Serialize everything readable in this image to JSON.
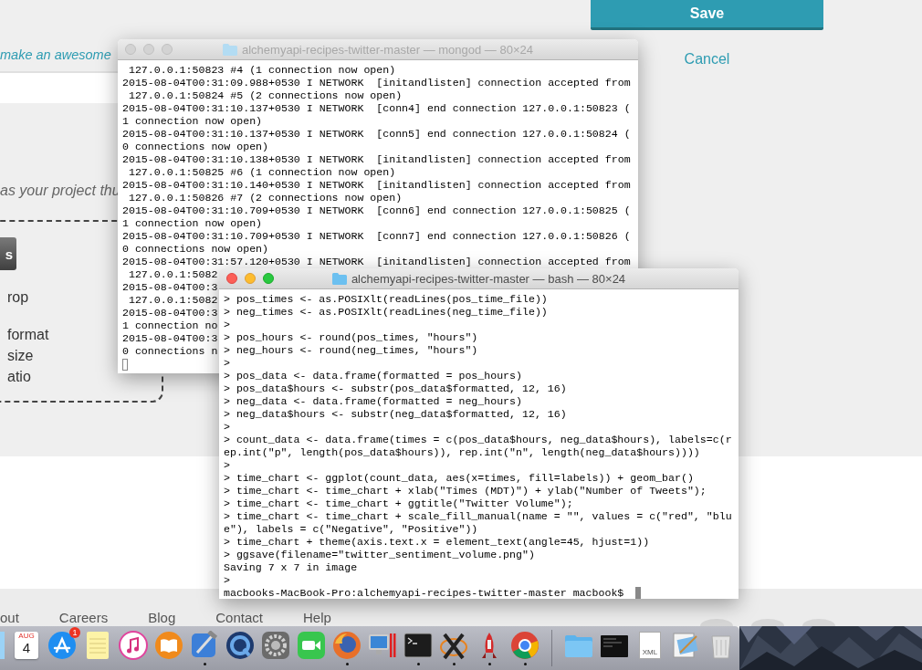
{
  "web_page": {
    "tagline": "make an awesome",
    "thumbnail_hint": "as your project thu",
    "upload_button": "s",
    "drop_hint": "rop",
    "requirements": [
      "format",
      "size",
      "atio"
    ],
    "save_button": "Save",
    "cancel_link": "Cancel",
    "footer_links": [
      "out",
      "Careers",
      "Blog",
      "Contact",
      "Help"
    ]
  },
  "windows": [
    {
      "title": "alchemyapi-recipes-twitter-master — mongod — 80×24",
      "active": false,
      "lines": [
        " 127.0.0.1:50823 #4 (1 connection now open)",
        "2015-08-04T00:31:09.988+0530 I NETWORK  [initandlisten] connection accepted from",
        " 127.0.0.1:50824 #5 (2 connections now open)",
        "2015-08-04T00:31:10.137+0530 I NETWORK  [conn4] end connection 127.0.0.1:50823 (",
        "1 connection now open)",
        "2015-08-04T00:31:10.137+0530 I NETWORK  [conn5] end connection 127.0.0.1:50824 (",
        "0 connections now open)",
        "2015-08-04T00:31:10.138+0530 I NETWORK  [initandlisten] connection accepted from",
        " 127.0.0.1:50825 #6 (1 connection now open)",
        "2015-08-04T00:31:10.140+0530 I NETWORK  [initandlisten] connection accepted from",
        " 127.0.0.1:50826 #7 (2 connections now open)",
        "2015-08-04T00:31:10.709+0530 I NETWORK  [conn6] end connection 127.0.0.1:50825 (",
        "1 connection now open)",
        "2015-08-04T00:31:10.709+0530 I NETWORK  [conn7] end connection 127.0.0.1:50826 (",
        "0 connections now open)",
        "2015-08-04T00:31:57.120+0530 I NETWORK  [initandlisten] connection accepted from",
        " 127.0.0.1:5082",
        "2015-08-04T00:3",
        " 127.0.0.1:5082",
        "2015-08-04T00:3",
        "1 connection no",
        "2015-08-04T00:3",
        "0 connections n"
      ]
    },
    {
      "title": "alchemyapi-recipes-twitter-master — bash — 80×24",
      "active": true,
      "lines": [
        "> pos_times <- as.POSIXlt(readLines(pos_time_file))",
        "> neg_times <- as.POSIXlt(readLines(neg_time_file))",
        ">",
        "> pos_hours <- round(pos_times, \"hours\")",
        "> neg_hours <- round(neg_times, \"hours\")",
        ">",
        "> pos_data <- data.frame(formatted = pos_hours)",
        "> pos_data$hours <- substr(pos_data$formatted, 12, 16)",
        "> neg_data <- data.frame(formatted = neg_hours)",
        "> neg_data$hours <- substr(neg_data$formatted, 12, 16)",
        ">",
        "> count_data <- data.frame(times = c(pos_data$hours, neg_data$hours), labels=c(r",
        "ep.int(\"p\", length(pos_data$hours)), rep.int(\"n\", length(neg_data$hours))))",
        ">",
        "> time_chart <- ggplot(count_data, aes(x=times, fill=labels)) + geom_bar()",
        "> time_chart <- time_chart + xlab(\"Times (MDT)\") + ylab(\"Number of Tweets\");",
        "> time_chart <- time_chart + ggtitle(\"Twitter Volume\");",
        "> time_chart <- time_chart + scale_fill_manual(name = \"\", values = c(\"red\", \"blu",
        "e\"), labels = c(\"Negative\", \"Positive\"))",
        "> time_chart + theme(axis.text.x = element_text(angle=45, hjust=1))",
        "> ggsave(filename=\"twitter_sentiment_volume.png\")",
        "Saving 7 x 7 in image",
        ">",
        "macbooks-MacBook-Pro:alchemyapi-recipes-twitter-master macbook$"
      ]
    }
  ],
  "dock": {
    "apps": [
      {
        "kind": "finder",
        "running": false
      },
      {
        "kind": "calendar",
        "month": "AUG",
        "day": "4",
        "running": false
      },
      {
        "kind": "app_store",
        "badge": "1",
        "running": false
      },
      {
        "kind": "notes",
        "running": false
      },
      {
        "kind": "music",
        "running": false
      },
      {
        "kind": "books",
        "running": false
      },
      {
        "kind": "xcode",
        "running": true
      },
      {
        "kind": "quicktime",
        "running": false
      },
      {
        "kind": "system_preferences",
        "running": false
      },
      {
        "kind": "facetime",
        "running": false
      },
      {
        "kind": "firefox",
        "running": true
      },
      {
        "kind": "parallels",
        "running": false
      },
      {
        "kind": "terminal",
        "running": true
      },
      {
        "kind": "x11",
        "running": true
      },
      {
        "kind": "rocket",
        "running": true
      },
      {
        "kind": "chrome",
        "running": true
      }
    ],
    "stacks": [
      {
        "kind": "folder",
        "running": false
      },
      {
        "kind": "dark_folder",
        "running": false
      },
      {
        "kind": "document",
        "label": "XML",
        "running": false
      },
      {
        "kind": "preview",
        "running": false
      },
      {
        "kind": "trash",
        "running": false
      }
    ]
  }
}
